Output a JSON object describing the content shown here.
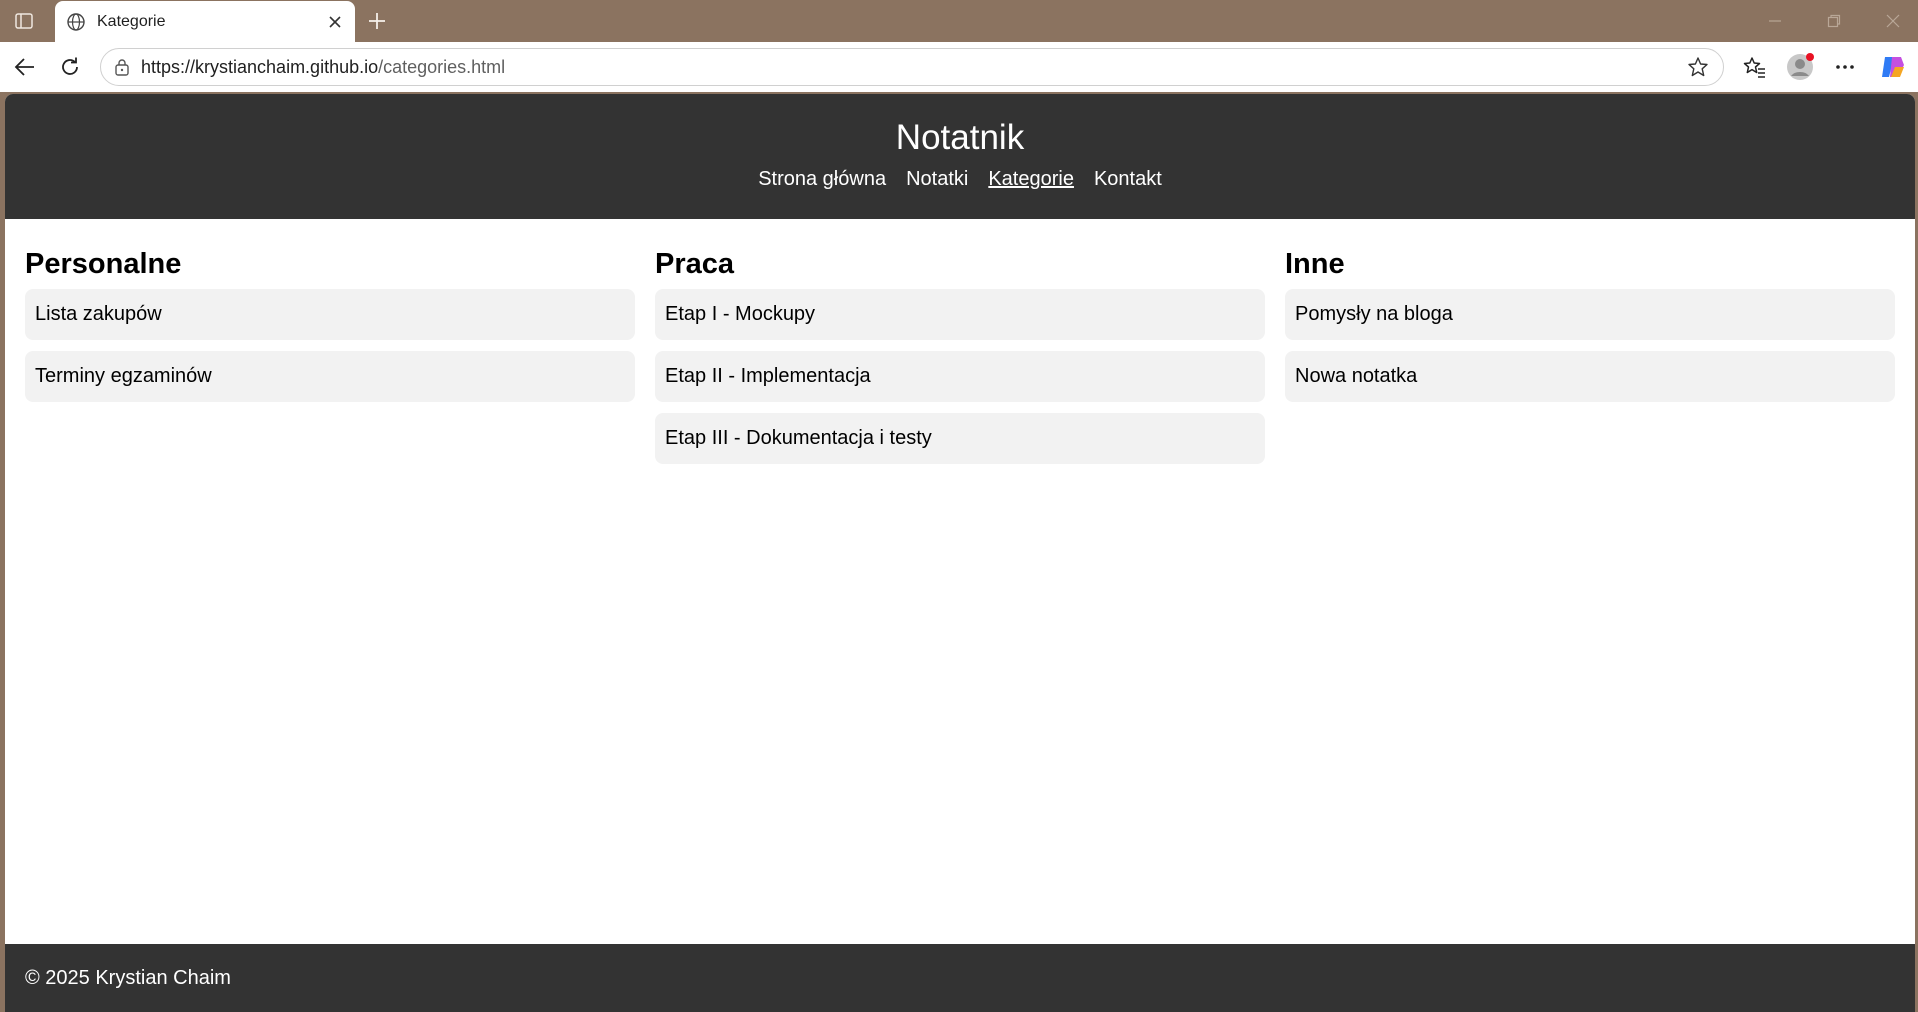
{
  "browser": {
    "tab_title": "Kategorie",
    "url_host": "https://krystianchaim.github.io",
    "url_path": "/categories.html",
    "icons": [
      "sidebar-icon",
      "globe-icon",
      "close-icon",
      "plus-icon",
      "back-icon",
      "refresh-icon",
      "lock-icon",
      "star-icon",
      "favorites-icon",
      "profile-icon",
      "more-icon",
      "copilot-icon",
      "minimize-icon",
      "restore-icon",
      "window-close-icon"
    ]
  },
  "site": {
    "title": "Notatnik",
    "nav": [
      "Strona główna",
      "Notatki",
      "Kategorie",
      "Kontakt"
    ],
    "active_nav": "Kategorie"
  },
  "categories": [
    {
      "name": "Personalne",
      "notes": [
        "Lista zakupów",
        "Terminy egzaminów"
      ]
    },
    {
      "name": "Praca",
      "notes": [
        "Etap I - Mockupy",
        "Etap II - Implementacja",
        "Etap III - Dokumentacja i testy"
      ]
    },
    {
      "name": "Inne",
      "notes": [
        "Pomysły na bloga",
        "Nowa notatka"
      ]
    }
  ],
  "footer": {
    "text": "© 2025 Krystian Chaim"
  },
  "colors": {
    "header_bg": "#333333",
    "card_bg": "#f2f2f2",
    "chrome_bg": "#8b7360"
  }
}
